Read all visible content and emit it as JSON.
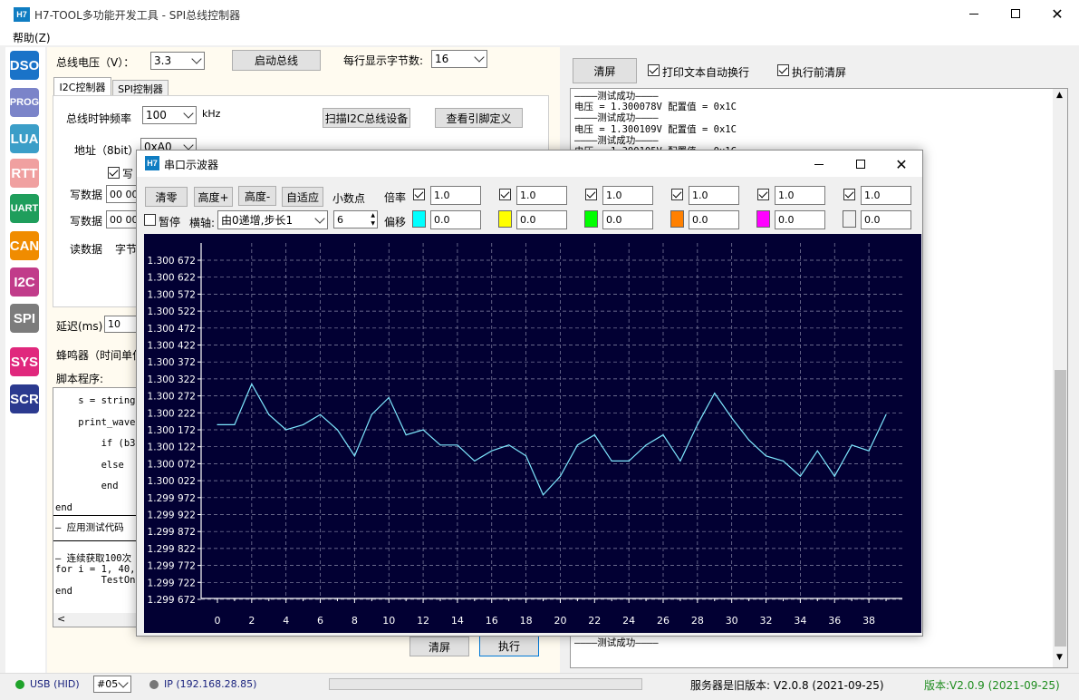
{
  "main_window": {
    "title": "H7-TOOL多功能开发工具 - SPI总线控制器",
    "icon_label": "H7",
    "menu": {
      "help": "帮助(Z)"
    }
  },
  "sidebar": {
    "items": [
      {
        "label": "DSO",
        "color": "#1a73c8"
      },
      {
        "label": "PROG",
        "color": "#7b84c9"
      },
      {
        "label": "LUA",
        "color": "#3b9ec8"
      },
      {
        "label": "RTT",
        "color": "#f0a0a0"
      },
      {
        "label": "UART",
        "color": "#1f9e5c"
      },
      {
        "label": "CAN",
        "color": "#f08c00"
      },
      {
        "label": "I2C",
        "color": "#c13c8a"
      },
      {
        "label": "SPI",
        "color": "#7c7c7c"
      },
      {
        "label": "SYS",
        "color": "#e0287d"
      },
      {
        "label": "SCR",
        "color": "#2b3a8f"
      }
    ]
  },
  "top_controls": {
    "bus_voltage_label": "总线电压（V）：",
    "bus_voltage_value": "3.3",
    "start_bus": "启动总线",
    "bytes_per_line_label": "每行显示字节数:",
    "bytes_per_line_value": "16"
  },
  "tabs": {
    "i2c": "I2C控制器",
    "spi": "SPI控制器"
  },
  "i2c_panel": {
    "clock_label": "总线时钟频率",
    "clock_value": "100",
    "clock_unit": "kHz",
    "scan_button": "扫描I2C总线设备",
    "pin_button": "查看引脚定义",
    "addr_label": "地址（8bit）",
    "addr_value": "0xA0",
    "write_cb_label": "写",
    "write_data_label_1": "写数据",
    "write_data_value_1": "00 00",
    "write_data_label_2": "写数据",
    "write_data_value_2": "00 00",
    "read_data_label": "读数据",
    "read_data_extra": "字节"
  },
  "delay": {
    "label": "延迟(ms)",
    "value": "10"
  },
  "beeper_label": "蜂鸣器（时间单位",
  "script": {
    "label": "脚本程序:",
    "lines": [
      "    s = string.",
      "    print_wave(",
      "        if (b3",
      "        else",
      "        end",
      "end"
    ],
    "separator_line": "—  应用测试代码",
    "lines2": [
      "— 连续获取100次",
      "for i = 1, 40,",
      "        TestOnc",
      "end"
    ]
  },
  "bottom_buttons": {
    "clear": "清屏",
    "execute": "执行"
  },
  "right_panel": {
    "clear": "清屏",
    "auto_wrap": "打印文本自动换行",
    "clear_before_exec": "执行前清屏",
    "log": [
      "————测试成功————",
      "电压 = 1.300078V 配置值 = 0x1C",
      "————测试成功————",
      "电压 = 1.300109V 配置值 = 0x1C",
      "————测试成功————",
      "电压 = 1.300105V 配置值 = 0x1C"
    ],
    "log_tail": "————测试成功————"
  },
  "status_bar": {
    "usb": "USB (HID)",
    "port": "#05",
    "ip": "IP (192.168.28.85)",
    "server_version": "服务器是旧版本: V2.0.8 (2021-09-25)",
    "version": "版本:V2.0.9 (2021-09-25)"
  },
  "oscilloscope": {
    "title": "串口示波器",
    "icon_label": "H7",
    "buttons": {
      "zero": "清零",
      "height_plus": "高度+",
      "height_minus": "高度-",
      "auto_fit": "自适应"
    },
    "decimals_label": "小数点",
    "decimals_value": "6",
    "pause_label": "暂停",
    "xaxis_label": "横轴:",
    "xaxis_value": "由0递增,步长1",
    "multiplier_label": "倍率",
    "offset_label": "偏移",
    "channels": [
      {
        "color": "#00ffff",
        "multiplier": "1.0",
        "offset": "0.0"
      },
      {
        "color": "#ffff00",
        "multiplier": "1.0",
        "offset": "0.0"
      },
      {
        "color": "#00ff00",
        "multiplier": "1.0",
        "offset": "0.0"
      },
      {
        "color": "#ff8000",
        "multiplier": "1.0",
        "offset": "0.0"
      },
      {
        "color": "#ff00ff",
        "multiplier": "1.0",
        "offset": "0.0"
      },
      {
        "color": "#f0f0f0",
        "multiplier": "1.0",
        "offset": "0.0"
      }
    ]
  },
  "chart_data": {
    "type": "line",
    "y_ticks": [
      "1.300 672",
      "1.300 622",
      "1.300 572",
      "1.300 522",
      "1.300 472",
      "1.300 422",
      "1.300 372",
      "1.300 322",
      "1.300 272",
      "1.300 222",
      "1.300 172",
      "1.300 122",
      "1.300 072",
      "1.300 022",
      "1.299 972",
      "1.299 922",
      "1.299 872",
      "1.299 822",
      "1.299 772",
      "1.299 722",
      "1.299 672"
    ],
    "x_ticks": [
      "0",
      "2",
      "4",
      "6",
      "8",
      "10",
      "12",
      "14",
      "16",
      "18",
      "20",
      "22",
      "24",
      "26",
      "28",
      "30",
      "32",
      "34",
      "36",
      "38"
    ],
    "ylim": [
      1.299672,
      1.300672
    ],
    "xlim": [
      0,
      39
    ],
    "grid": true,
    "series": [
      {
        "color": "#7fe8ff",
        "x": [
          0,
          1,
          2,
          3,
          4,
          5,
          6,
          7,
          8,
          9,
          10,
          11,
          12,
          13,
          14,
          15,
          16,
          17,
          18,
          19,
          20,
          21,
          22,
          23,
          24,
          25,
          26,
          27,
          28,
          29,
          30,
          31,
          32,
          33,
          34,
          35,
          36,
          37,
          38,
          39
        ],
        "y": [
          1.300187,
          1.300187,
          1.300307,
          1.300217,
          1.300172,
          1.300187,
          1.300217,
          1.300172,
          1.300095,
          1.300217,
          1.300267,
          1.300157,
          1.300172,
          1.300127,
          1.300127,
          1.30008,
          1.30011,
          1.300127,
          1.300095,
          1.29998,
          1.300035,
          1.300127,
          1.300157,
          1.30008,
          1.30008,
          1.300127,
          1.300157,
          1.30008,
          1.300187,
          1.30028,
          1.300207,
          1.300142,
          1.300095,
          1.30008,
          1.300035,
          1.30011,
          1.300035,
          1.300127,
          1.30011,
          1.300217
        ]
      }
    ]
  }
}
